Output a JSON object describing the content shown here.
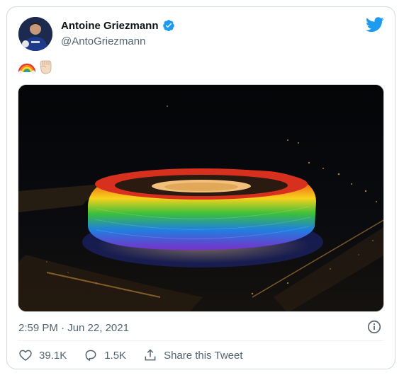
{
  "tweet": {
    "author_name": "Antoine Griezmann",
    "author_handle": "@AntoGriezmann",
    "verified": true,
    "body_icons": [
      "rainbow-icon",
      "raised-fist-icon"
    ],
    "timestamp": "2:59 PM · Jun 22, 2021",
    "image_description_icon": "stadium-photo"
  },
  "actions": {
    "like_count": "39.1K",
    "reply_count": "1.5K",
    "share_label": "Share this Tweet"
  },
  "colors": {
    "brand": "#1d9bf0",
    "text": "#0f1419",
    "muted": "#536471",
    "border": "#cfd9de"
  }
}
